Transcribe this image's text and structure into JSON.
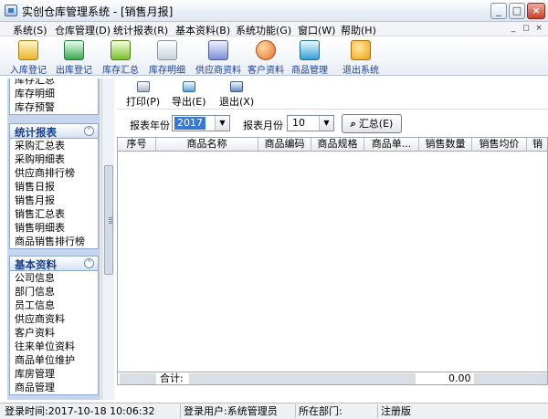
{
  "window": {
    "title": "实创仓库管理系统 - [销售月报]",
    "controls": {
      "minimize": "_",
      "maximize": "□",
      "close": "×"
    }
  },
  "menubar": {
    "items": [
      "系统(S)",
      "仓库管理(D)",
      "统计报表(R)",
      "基本资料(B)",
      "系统功能(G)",
      "窗口(W)",
      "帮助(H)"
    ],
    "mdi_controls": {
      "minimize": "_",
      "restore": "◻",
      "close": "×"
    }
  },
  "toolbar": {
    "buttons": [
      {
        "label": "入库登记",
        "icon": "inbound-icon"
      },
      {
        "label": "出库登记",
        "icon": "outbound-icon"
      },
      {
        "label": "库存汇总",
        "icon": "stock-summary-icon"
      },
      {
        "label": "库存明细",
        "icon": "stock-detail-icon"
      },
      {
        "label": "供应商资料",
        "icon": "supplier-icon"
      },
      {
        "label": "客户资料",
        "icon": "customer-icon"
      },
      {
        "label": "商品管理",
        "icon": "product-icon"
      },
      {
        "label": "退出系统",
        "icon": "power-icon"
      }
    ]
  },
  "sidebar": {
    "top_items": [
      "库存汇总",
      "库存明细",
      "库存预警"
    ],
    "groups": [
      {
        "title": "统计报表",
        "toggle": "˄",
        "items": [
          "采购汇总表",
          "采购明细表",
          "供应商排行榜",
          "销售日报",
          "销售月报",
          "销售汇总表",
          "销售明细表",
          "商品销售排行榜"
        ]
      },
      {
        "title": "基本资料",
        "toggle": "˄",
        "items": [
          "公司信息",
          "部门信息",
          "员工信息",
          "供应商资料",
          "客户资料",
          "往来单位资料",
          "商品单位维护",
          "库房管理",
          "商品管理"
        ]
      }
    ]
  },
  "report": {
    "tools": {
      "print": "打印(P)",
      "export": "导出(E)",
      "exit": "退出(X)"
    },
    "filter": {
      "year_label": "报表年份",
      "year_value": "2017",
      "month_label": "报表月份",
      "month_value": "10",
      "summary_button": "汇总(E)"
    },
    "columns": [
      "序号",
      "商品名称",
      "商品编码",
      "商品规格",
      "商品单...",
      "销售数量",
      "销售均价",
      "销"
    ],
    "footer": {
      "total_label": "合计:",
      "total_value": "0.00"
    }
  },
  "statusbar": {
    "login_time": "登录时间:2017-10-18 10:06:32",
    "login_user": "登录用户:系统管理员",
    "department": "所在部门:",
    "edition": "注册版"
  }
}
